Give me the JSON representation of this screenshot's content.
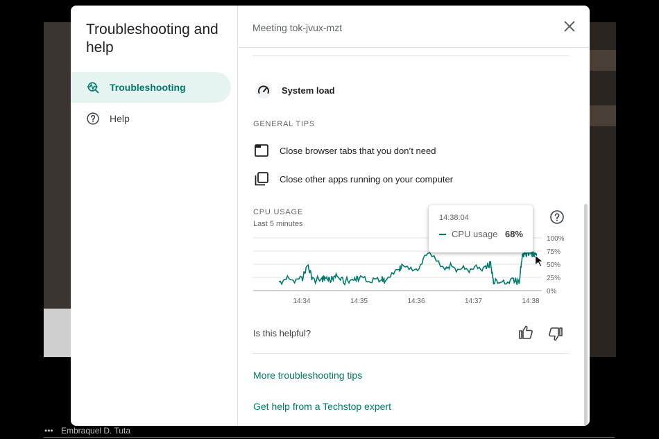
{
  "dialog": {
    "title": "Troubleshooting and help",
    "meeting": "Meeting tok-jvux-mzt"
  },
  "sidebar": {
    "items": [
      {
        "label": "Troubleshooting",
        "icon": "troubleshoot-icon",
        "active": true
      },
      {
        "label": "Help",
        "icon": "help-circle-icon",
        "active": false
      }
    ]
  },
  "system_load": {
    "label": "System load",
    "icon": "speedometer-icon"
  },
  "general_tips": {
    "heading": "GENERAL TIPS",
    "items": [
      {
        "text": "Close browser tabs that you don’t need",
        "icon": "browser-tab-icon"
      },
      {
        "text": "Close other apps running on your computer",
        "icon": "apps-icon"
      }
    ]
  },
  "cpu": {
    "heading": "CPU USAGE",
    "subheading": "Last 5 minutes",
    "tooltip": {
      "time": "14:38:04",
      "series": "CPU usage",
      "value": "68%"
    }
  },
  "chart_data": {
    "type": "line",
    "title": "CPU USAGE",
    "subtitle": "Last 5 minutes",
    "x_tick_labels": [
      "14:34",
      "14:35",
      "14:36",
      "14:37",
      "14:38"
    ],
    "y_tick_labels": [
      "100%",
      "75%",
      "50%",
      "25%",
      "0%"
    ],
    "ylim": [
      0,
      100
    ],
    "x_minutes": [
      13.6,
      13.8,
      14.0,
      14.1,
      14.2,
      14.35,
      14.4,
      14.5,
      14.6,
      14.75,
      14.9,
      15.0,
      15.2,
      15.4,
      15.45,
      15.7,
      15.75,
      16.0,
      16.2,
      16.5,
      16.6,
      16.8,
      17.0,
      17.2,
      17.3,
      17.35,
      17.5,
      17.7,
      17.8,
      17.85,
      17.9,
      18.0,
      18.07
    ],
    "values": [
      18,
      22,
      20,
      48,
      20,
      22,
      25,
      20,
      28,
      18,
      20,
      25,
      18,
      22,
      18,
      40,
      45,
      38,
      70,
      42,
      45,
      40,
      42,
      44,
      50,
      18,
      15,
      20,
      15,
      65,
      70,
      72,
      68
    ],
    "series": [
      {
        "name": "CPU usage",
        "color": "#00796b"
      }
    ],
    "grid": true,
    "y_axis_position": "right"
  },
  "feedback": {
    "question": "Is this helpful?",
    "thumbs_up_icon": "thumbs-up-icon",
    "thumbs_down_icon": "thumbs-down-icon"
  },
  "links": {
    "more_tips": "More troubleshooting tips",
    "techstop": "Get help from a Techstop expert"
  },
  "participant": {
    "name": "Embraquel D. Tuta"
  },
  "colors": {
    "accent": "#00796b",
    "active_bg": "#e6f4f1"
  }
}
